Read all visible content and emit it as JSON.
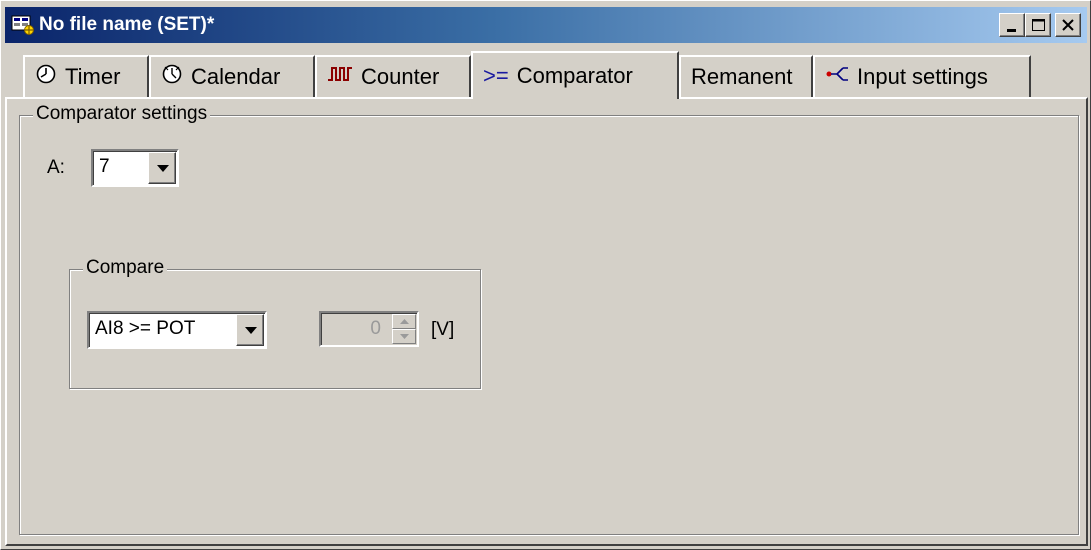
{
  "window": {
    "title": "No file name (SET)*",
    "app_icon": "program-icon",
    "controls": [
      "minimize-icon",
      "maximize-icon",
      "close-icon"
    ]
  },
  "tabs": [
    {
      "label": "Timer",
      "icon": "clock-icon",
      "active": false
    },
    {
      "label": "Calendar",
      "icon": "calendar-clock-icon",
      "active": false
    },
    {
      "label": "Counter",
      "icon": "counter-pulse-icon",
      "active": false
    },
    {
      "label": "Comparator",
      "icon_text": ">=",
      "active": true
    },
    {
      "label": "Remanent",
      "active": false
    },
    {
      "label": "Input settings",
      "icon": "input-branch-icon",
      "active": false
    }
  ],
  "comparator_settings": {
    "group_label": "Comparator settings",
    "a_label": "A:",
    "a_value": "7",
    "compare": {
      "group_label": "Compare",
      "operation": "AI8 >= POT",
      "threshold": "0",
      "unit": "[V]"
    }
  },
  "colors": {
    "face": "#d4d0c8",
    "title_start": "#0a246a",
    "title_end": "#a6caf0",
    "counter_icon": "#8b0000",
    "comparator_icon": "#1a1aa0"
  }
}
